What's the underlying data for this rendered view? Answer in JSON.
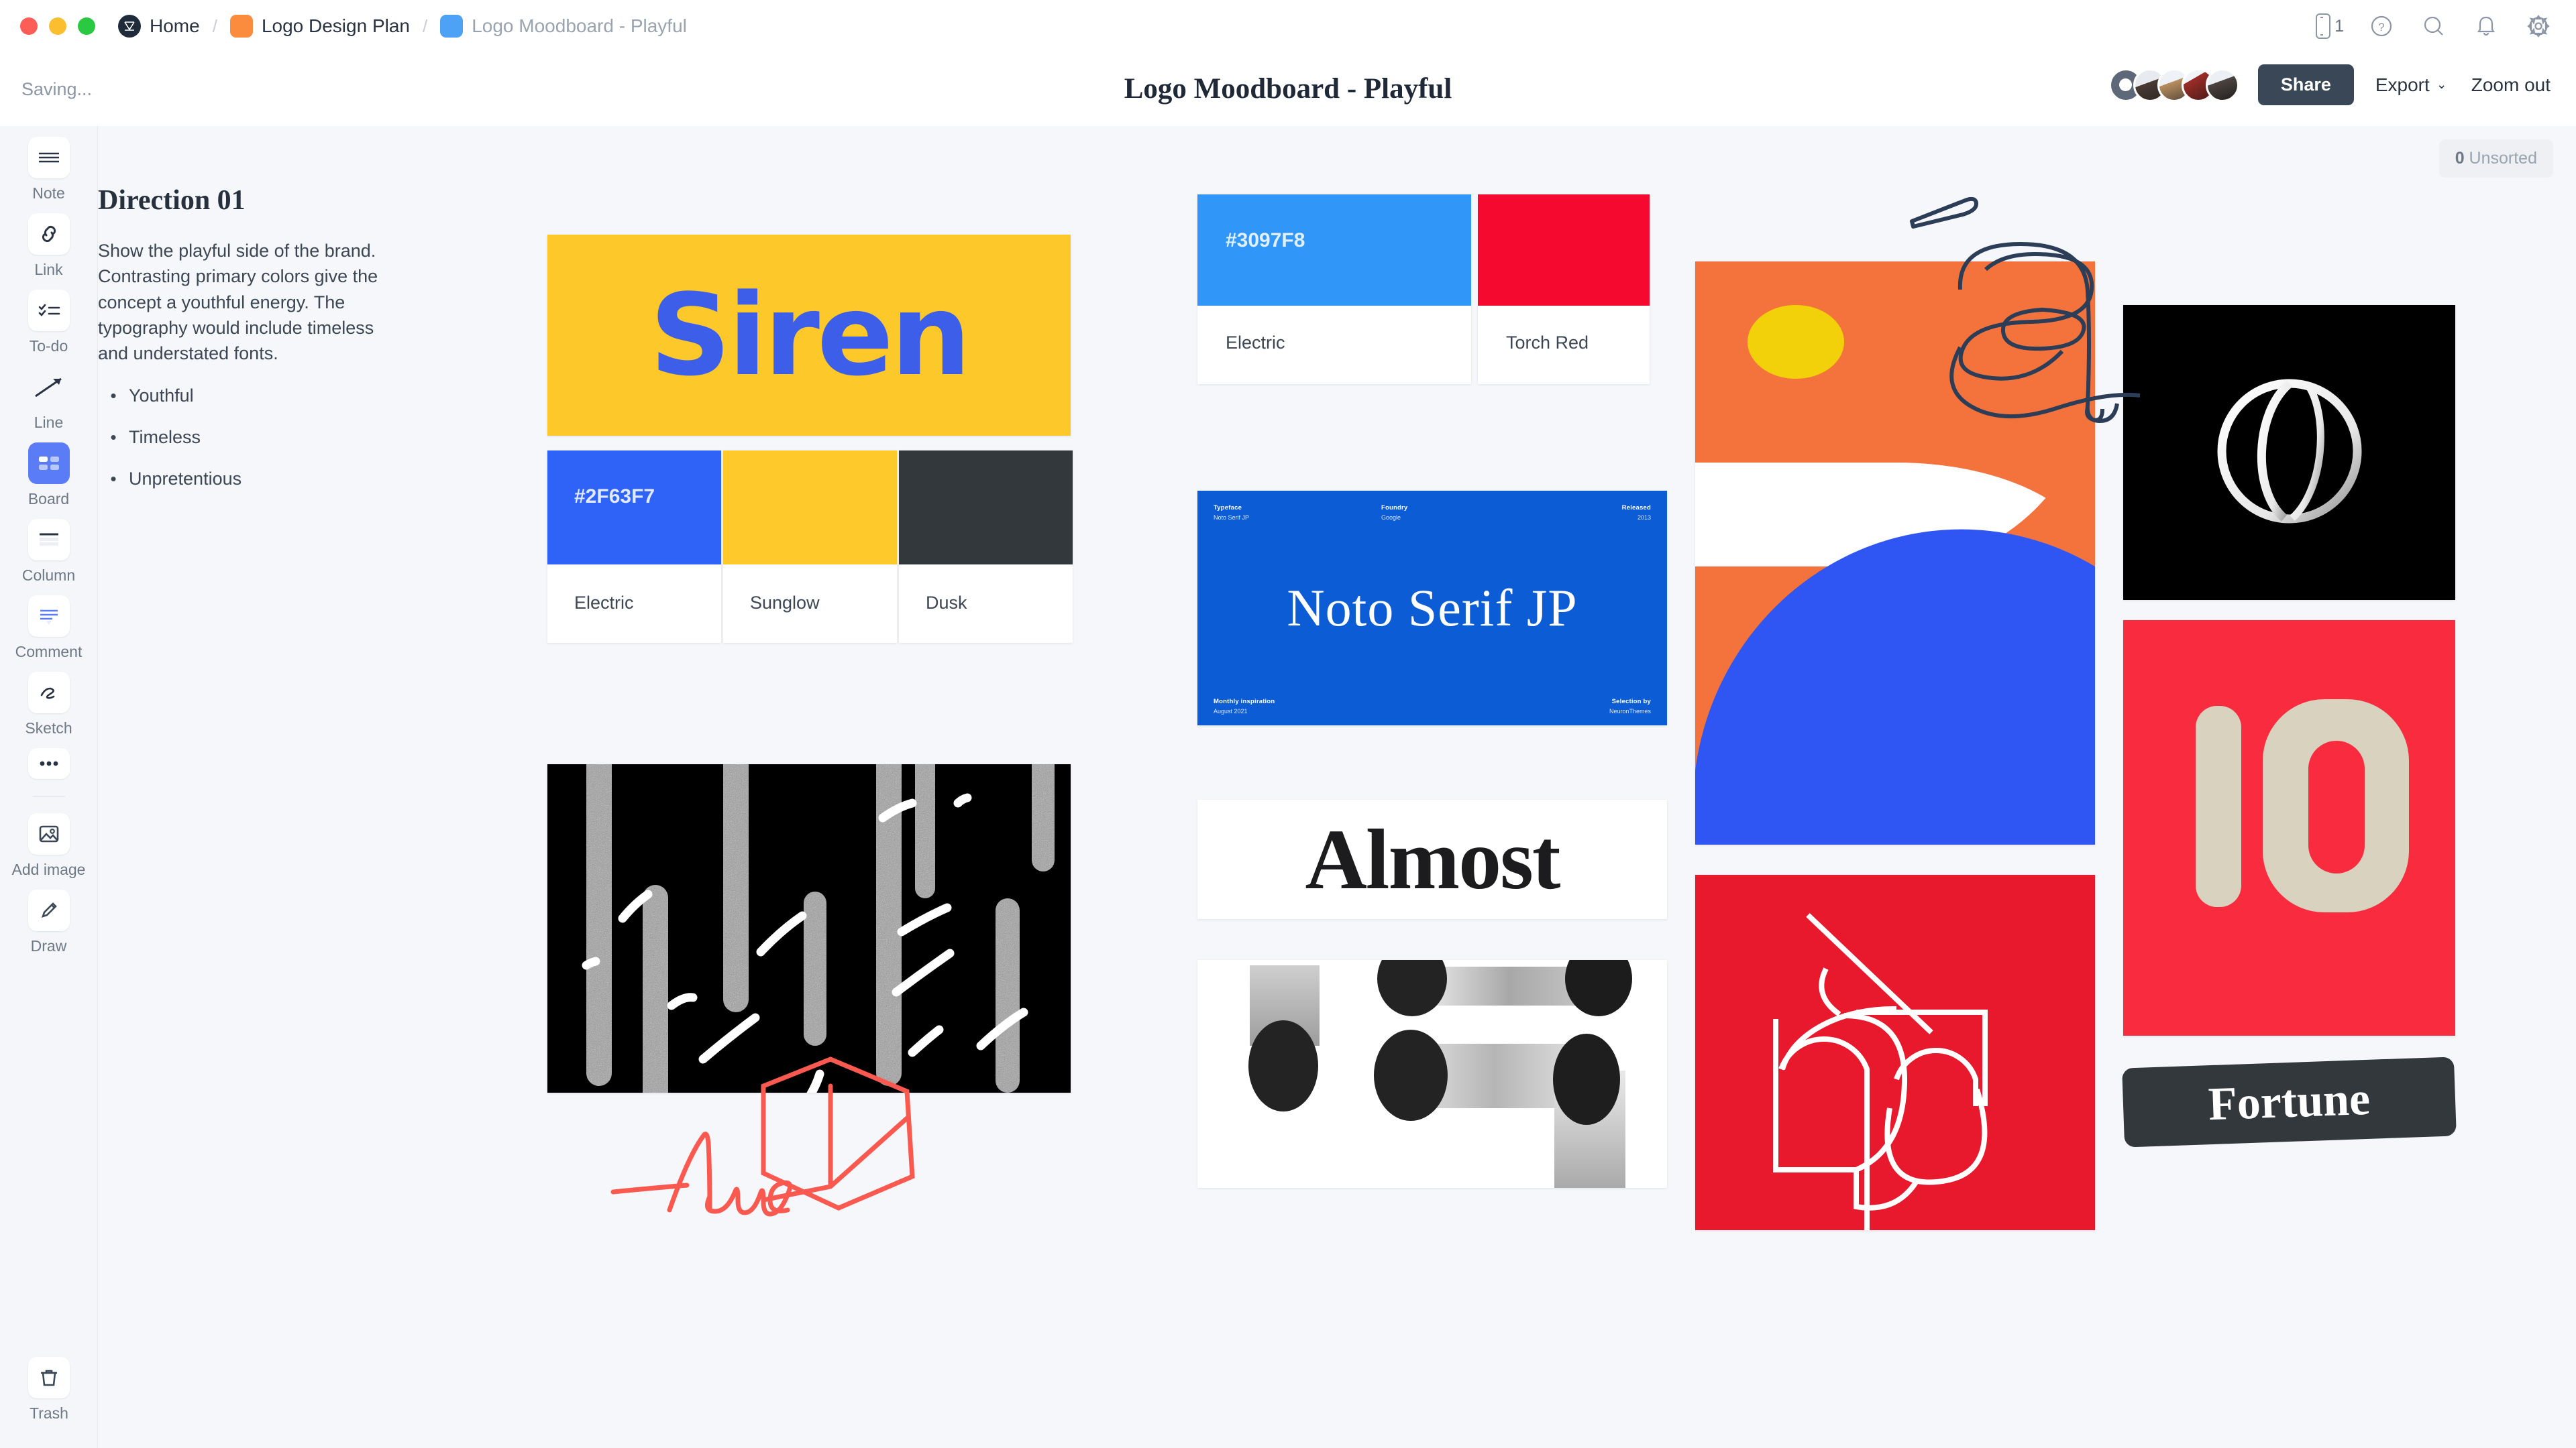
{
  "window": {
    "traffic_lights": [
      "close",
      "minimize",
      "maximize"
    ]
  },
  "breadcrumb": {
    "items": [
      {
        "label": "Home",
        "icon": "milanote-logo-icon",
        "muted": false
      },
      {
        "label": "Logo Design Plan",
        "icon": "orange-square-icon",
        "muted": false
      },
      {
        "label": "Logo Moodboard - Playful",
        "icon": "blue-square-icon",
        "muted": true
      }
    ],
    "separator": "/"
  },
  "topbar": {
    "icons": [
      {
        "name": "mobile-icon",
        "badge": "1"
      },
      {
        "name": "help-icon"
      },
      {
        "name": "search-icon"
      },
      {
        "name": "notifications-bell-icon"
      },
      {
        "name": "settings-gear-icon"
      }
    ]
  },
  "subbar": {
    "status": "Saving...",
    "title": "Logo Moodboard - Playful",
    "share_label": "Share",
    "export_label": "Export",
    "export_caret": "⌄",
    "zoom_label": "Zoom out",
    "collaborators": 5
  },
  "sidebar": {
    "items": [
      {
        "label": "Note",
        "icon": "note-lines-icon",
        "active": false
      },
      {
        "label": "Link",
        "icon": "link-chain-icon",
        "active": false
      },
      {
        "label": "To-do",
        "icon": "todo-checklist-icon",
        "active": false
      },
      {
        "label": "Line",
        "icon": "arrow-line-icon",
        "active": false,
        "plain": true
      },
      {
        "label": "Board",
        "icon": "board-grid-icon",
        "active": true
      },
      {
        "label": "Column",
        "icon": "column-icon",
        "active": false
      },
      {
        "label": "Comment",
        "icon": "comment-bubble-icon",
        "active": false
      },
      {
        "label": "Sketch",
        "icon": "sketch-squiggle-icon",
        "active": false
      },
      {
        "label": "",
        "icon": "more-dots-icon",
        "active": false
      }
    ],
    "tools_after_divider": [
      {
        "label": "Add image",
        "icon": "add-image-icon"
      },
      {
        "label": "Draw",
        "icon": "pencil-draw-icon"
      }
    ],
    "trash": {
      "label": "Trash",
      "icon": "trash-bin-icon"
    },
    "accent_color": "#5A7CF6"
  },
  "canvas": {
    "unsorted_count": "0",
    "unsorted_label": "Unsorted",
    "background": "#F5F7FA"
  },
  "direction": {
    "title": "Direction 01",
    "body": "Show the playful side of the brand. Contrasting primary colors give the concept a youthful energy. The typography would include timeless and understated fonts.",
    "bullets": [
      "Youthful",
      "Timeless",
      "Unpretentious"
    ],
    "bullet_glyph": "•"
  },
  "siren_card": {
    "word": "Siren",
    "background": "#FDC82A",
    "text_color": "#3D5EE8"
  },
  "palette_small": {
    "swatches": [
      {
        "hex": "#2F63F7",
        "name": "Electric",
        "show_hex": true
      },
      {
        "hex": "#FDC92B",
        "name": "Sunglow",
        "show_hex": false
      },
      {
        "hex": "#33383C",
        "name": "Dusk",
        "show_hex": false
      }
    ]
  },
  "palette_large": {
    "swatches": [
      {
        "hex": "#3097F8",
        "name": "Electric",
        "show_hex": true,
        "width": "wide"
      },
      {
        "hex": "#F5092F",
        "name": "Torch Red",
        "show_hex": false,
        "width": "narrow"
      }
    ]
  },
  "noto_card": {
    "headline": "Noto Serif JP",
    "background": "#0B5CD5",
    "meta": [
      {
        "key": "Typeface",
        "value": "Noto Serif JP"
      },
      {
        "key": "Foundry",
        "value": "Google"
      },
      {
        "key": "Released",
        "value": "2013"
      },
      {
        "key": "Monthly inspiration",
        "value": "August 2021"
      },
      {
        "key": "Selection by",
        "value": "NeuronThemes"
      }
    ]
  },
  "almost_card": {
    "word": "Almost",
    "background": "#FFFFFF",
    "text_color": "#1C1C1E"
  },
  "fortune_card": {
    "word": "Fortune",
    "background": "#33383C",
    "text_color": "#FFFFFF"
  },
  "image_cards": [
    {
      "name": "noise-texture-bars",
      "background": "#000000"
    },
    {
      "name": "grayscale-abstract-capsules",
      "background": "#FFFFFF"
    },
    {
      "name": "orange-geometric-shapes",
      "background": "#F4733C"
    },
    {
      "name": "red-line-monogram",
      "background": "#E8192C"
    },
    {
      "name": "black-sphere-monogram",
      "background": "#000000"
    },
    {
      "name": "red-cardboard-ten",
      "background": "#F92C3F"
    }
  ],
  "sketches": [
    {
      "name": "acme-signature-sketch",
      "color": "#F9594F"
    },
    {
      "name": "isometric-box-sketch",
      "color": "#F9594F"
    },
    {
      "name": "letter-a-outline-sketch",
      "color": "#2C3E57"
    }
  ]
}
